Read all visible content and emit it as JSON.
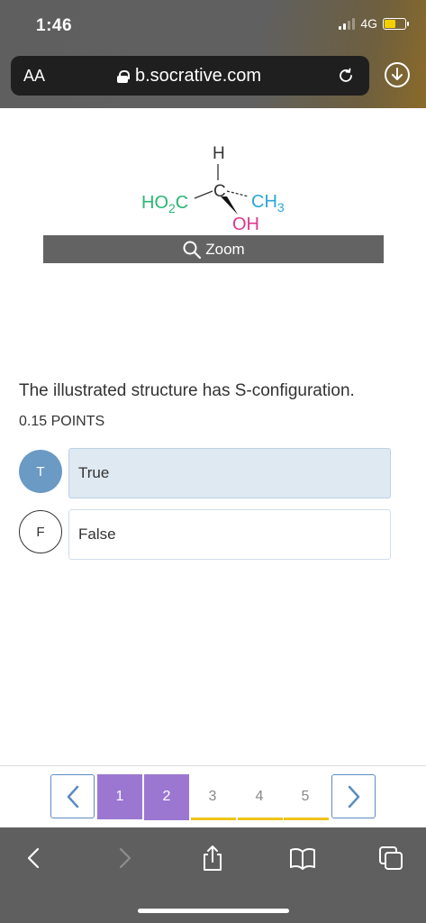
{
  "status_bar": {
    "time": "1:46",
    "network": "4G"
  },
  "browser": {
    "text_size_label": "AA",
    "url": "b.socrative.com"
  },
  "diagram": {
    "h": "H",
    "c": "C",
    "ho2c": "HO",
    "ho2c_sub": "2",
    "ho2c_tail": "C",
    "ch3": "CH",
    "ch3_sub": "3",
    "oh": "OH"
  },
  "zoom_label": "Zoom",
  "question": {
    "text": "The illustrated structure has S-configuration.",
    "points": "0.15 POINTS"
  },
  "choices": [
    {
      "letter": "T",
      "label": "True",
      "selected": true
    },
    {
      "letter": "F",
      "label": "False",
      "selected": false
    }
  ],
  "pagination": {
    "pages": [
      "1",
      "2",
      "3",
      "4",
      "5"
    ],
    "current": "2"
  },
  "colors": {
    "accent_purple": "#9b77d1",
    "selected_blue": "#6b9ac4",
    "pending_yellow": "#f0c419",
    "nav_border": "#5b8cc0"
  }
}
